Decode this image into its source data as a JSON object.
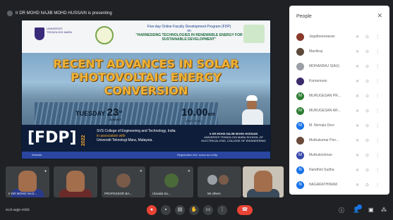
{
  "presenting": {
    "text": "Ir DR MOHD NAJIB MOHD HUSSAIN is presenting"
  },
  "slide": {
    "program_line": "Five-day Online Faculty Development Program (FDP)",
    "on_line": "on",
    "subtitle": "\"HARNESSING TECHNOLOGIES IN RENEWABLE ENERGY FOR SUSTAINABLE DEVELOPMENT\"",
    "university_name": "UNIVERSITI TEKNOLOGI MARA",
    "title": "RECENT ADVANCES IN SOLAR PHOTOVOLTAIC ENERGY CONVERSION",
    "day": "TUESDAY",
    "date": "23",
    "date_suffix": "rd",
    "month": "AUGUST",
    "time": "10.00",
    "time_suffix": "am",
    "timezone": "(GMT +5.30)",
    "fdp_tag": "[FDP]",
    "year": "2022",
    "college": "SVS College of Engineering and Technology, India",
    "in_association": "in association with",
    "partner": "Universiti Teknologi Mara, Malaysia.",
    "presenter": "Ir DR MOHD NAJIB MOHD HUSSAIN",
    "presenter_school": "UNIVERSITI TEKNOLOGI MARA SCHOOL OF ELECTRICAL ENG. COLLEGE OF ENGINEERING",
    "footer_left": "Website",
    "footer_right": "Registration link: svsce.ac.in/fdp"
  },
  "people": {
    "title": "People",
    "participants": [
      {
        "name": "Jegatheeswaran",
        "color": "#8a3a2a"
      },
      {
        "name": "Manikraj",
        "color": "#5c4a3a"
      },
      {
        "name": "MOHANRAJ S(AU)",
        "color": "#9aa0a6"
      },
      {
        "name": "Kumaresan",
        "color": "#3a2a6a"
      },
      {
        "name": "MURUGESAN PR...",
        "color": "#2e7d32",
        "initial": "M"
      },
      {
        "name": "MURUGESAN AR...",
        "color": "#2e7d32",
        "initial": "M"
      },
      {
        "name": "M. Nirmala Devi",
        "color": "#1a73e8",
        "initial": "M"
      },
      {
        "name": "Muthukumar Pon...",
        "color": "#6a4a3a"
      },
      {
        "name": "Muthukrishnan",
        "color": "#3949ab",
        "initial": "M"
      },
      {
        "name": "Nandhini Sudha",
        "color": "#1a73e8",
        "initial": "N"
      },
      {
        "name": "NAGARATHINAM",
        "color": "#1a73e8",
        "initial": "N"
      }
    ]
  },
  "tiles": [
    {
      "name": "Ir DR MOHD NAJI..."
    },
    {
      "name": ""
    },
    {
      "name": "PROFESSOR BA..."
    },
    {
      "name": "Ulavala Sa..."
    },
    {
      "name": "56 others"
    },
    {
      "name": ""
    }
  ],
  "bottom": {
    "meeting_code": "ecd-aqjo-mbb"
  },
  "colors": {
    "end_call": "#ea4335",
    "accent": "#1a73e8",
    "title_orange": "#f2b233"
  }
}
